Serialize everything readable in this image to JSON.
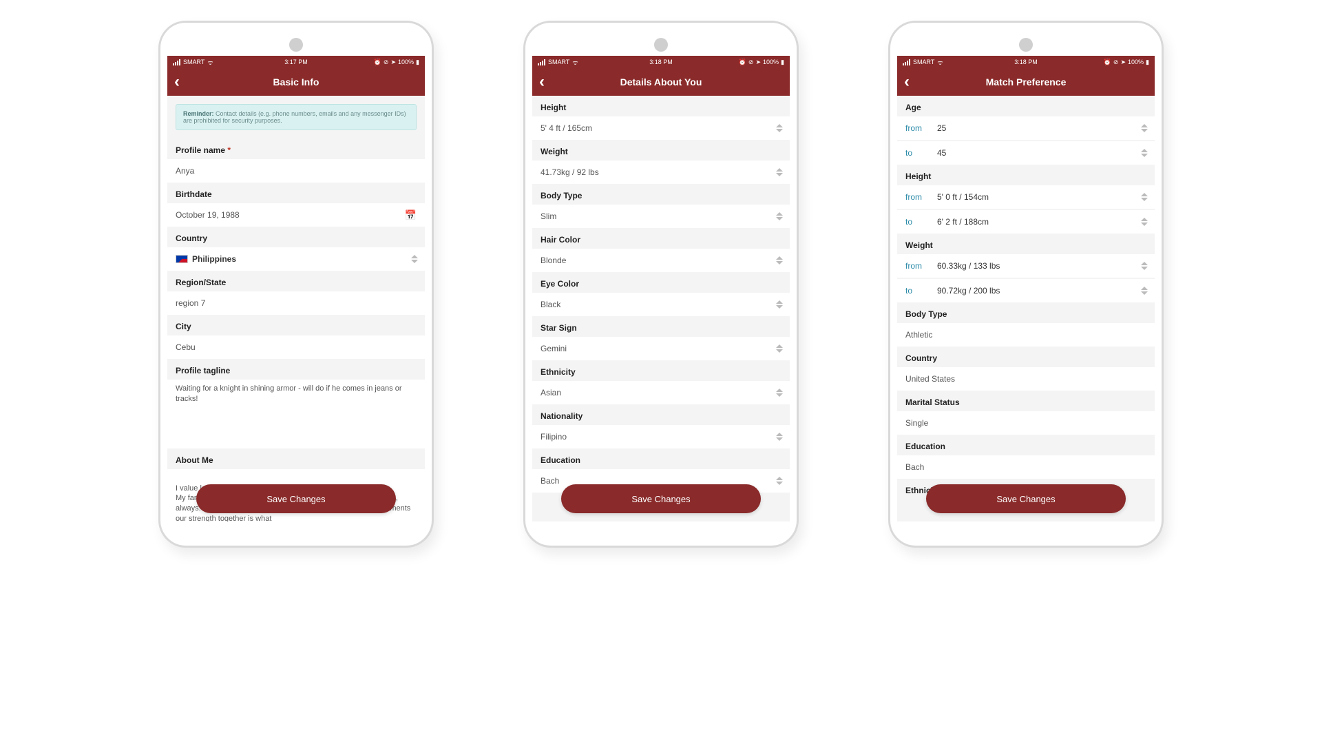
{
  "status": {
    "carrier": "SMART",
    "battery_text": "100%",
    "icons": {
      "alarm": "⏰",
      "lock": "⊘",
      "nav": "➤",
      "wifi": "ᯤ",
      "battery": "▮"
    }
  },
  "save_label": "Save Changes",
  "phone1": {
    "time": "3:17 PM",
    "title": "Basic Info",
    "reminder_label": "Reminder:",
    "reminder_text": "Contact details (e.g. phone numbers, emails and any messenger IDs) are prohibited for security purposes.",
    "profile_name_label": "Profile name",
    "profile_name_value": "Anya",
    "birthdate_label": "Birthdate",
    "birthdate_value": "October 19, 1988",
    "country_label": "Country",
    "country_value": "Philippines",
    "region_label": "Region/State",
    "region_value": "region 7",
    "city_label": "City",
    "city_value": "Cebu",
    "tagline_label": "Profile tagline",
    "tagline_value": "Waiting for a knight in shining armor - will do if he comes in jeans or tracks!",
    "about_label": "About Me",
    "about_value": "I value loyalty and honesty above everything else in my partner.\nMy family is the most important thing in my life. Family comes first, always. We've been through a lot together and in those hard moments our strength together is what"
  },
  "phone2": {
    "time": "3:18 PM",
    "title": "Details About You",
    "fields": [
      {
        "label": "Height",
        "value": "5' 4 ft / 165cm"
      },
      {
        "label": "Weight",
        "value": "41.73kg / 92 lbs"
      },
      {
        "label": "Body Type",
        "value": "Slim"
      },
      {
        "label": "Hair Color",
        "value": "Blonde"
      },
      {
        "label": "Eye Color",
        "value": "Black"
      },
      {
        "label": "Star Sign",
        "value": "Gemini"
      },
      {
        "label": "Ethnicity",
        "value": "Asian"
      },
      {
        "label": "Nationality",
        "value": "Filipino"
      },
      {
        "label": "Education",
        "value": "Bach"
      }
    ]
  },
  "phone3": {
    "time": "3:18 PM",
    "title": "Match Preference",
    "from_label": "from",
    "to_label": "to",
    "age_label": "Age",
    "age_from": "25",
    "age_to": "45",
    "height_label": "Height",
    "height_from": "5' 0 ft / 154cm",
    "height_to": "6' 2 ft / 188cm",
    "weight_label": "Weight",
    "weight_from": "60.33kg / 133 lbs",
    "weight_to": "90.72kg / 200 lbs",
    "body_type_label": "Body Type",
    "body_type_value": "Athletic",
    "country_label": "Country",
    "country_value": "United States",
    "marital_label": "Marital Status",
    "marital_value": "Single",
    "education_label": "Education",
    "education_value": "Bach",
    "ethnicity_label": "Ethnicity"
  }
}
